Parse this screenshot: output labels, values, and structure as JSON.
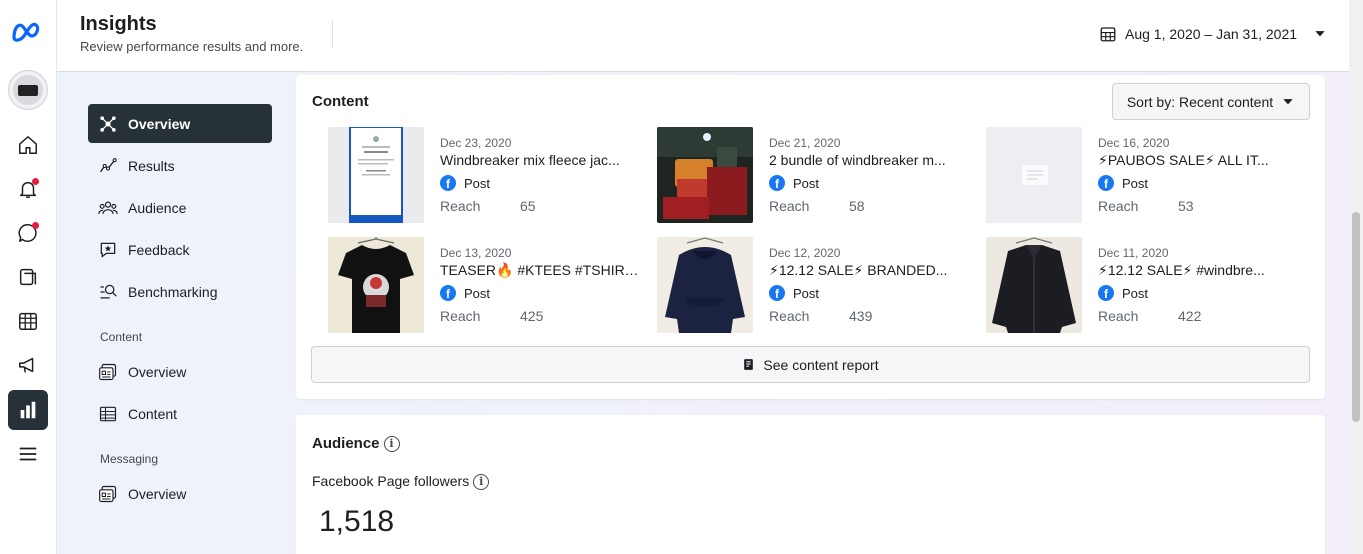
{
  "header": {
    "title": "Insights",
    "subtitle": "Review performance results and more.",
    "date_range": "Aug 1, 2020 – Jan 31, 2021"
  },
  "rail": {
    "icons": [
      "meta-logo",
      "page-avatar",
      "home-icon",
      "notifications-icon",
      "messages-icon",
      "pages-icon",
      "planner-icon",
      "ads-icon",
      "insights-icon",
      "menu-icon"
    ]
  },
  "nav": {
    "items": [
      {
        "label": "Overview",
        "icon": "network-icon"
      },
      {
        "label": "Results",
        "icon": "trend-line-icon"
      },
      {
        "label": "Audience",
        "icon": "people-icon"
      },
      {
        "label": "Feedback",
        "icon": "feedback-icon"
      },
      {
        "label": "Benchmarking",
        "icon": "benchmark-icon"
      }
    ],
    "content_section": "Content",
    "content_items": [
      {
        "label": "Overview",
        "icon": "content-overview-icon"
      },
      {
        "label": "Content",
        "icon": "table-icon"
      }
    ],
    "messaging_section": "Messaging",
    "messaging_items": [
      {
        "label": "Overview",
        "icon": "messaging-overview-icon"
      }
    ]
  },
  "content": {
    "title": "Content",
    "sort_label": "Sort by: Recent content",
    "see_report": "See content report",
    "posts": [
      {
        "date": "Dec 23, 2020",
        "title": "Windbreaker mix fleece jac...",
        "type": "Post",
        "reach_label": "Reach",
        "reach": "65",
        "thumb": "receipt"
      },
      {
        "date": "Dec 21, 2020",
        "title": "2 bundle of windbreaker m...",
        "type": "Post",
        "reach_label": "Reach",
        "reach": "58",
        "thumb": "bundle"
      },
      {
        "date": "Dec 16, 2020",
        "title": "⚡PAUBOS SALE⚡ ALL IT...",
        "type": "Post",
        "reach_label": "Reach",
        "reach": "53",
        "thumb": "placeholder"
      },
      {
        "date": "Dec 13, 2020",
        "title": "TEASER🔥 #KTEES #TSHIRT...",
        "type": "Post",
        "reach_label": "Reach",
        "reach": "425",
        "thumb": "tshirt"
      },
      {
        "date": "Dec 12, 2020",
        "title": "⚡12.12 SALE⚡ BRANDED...",
        "type": "Post",
        "reach_label": "Reach",
        "reach": "439",
        "thumb": "hoodie"
      },
      {
        "date": "Dec 11, 2020",
        "title": "⚡12.12 SALE⚡ #windbre...",
        "type": "Post",
        "reach_label": "Reach",
        "reach": "422",
        "thumb": "jacket"
      }
    ]
  },
  "audience": {
    "title": "Audience",
    "followers_label": "Facebook Page followers",
    "followers_value": "1,518"
  },
  "colors": {
    "accent": "#1877f2",
    "nav_active": "#263238",
    "notification": "#e41e3f"
  }
}
